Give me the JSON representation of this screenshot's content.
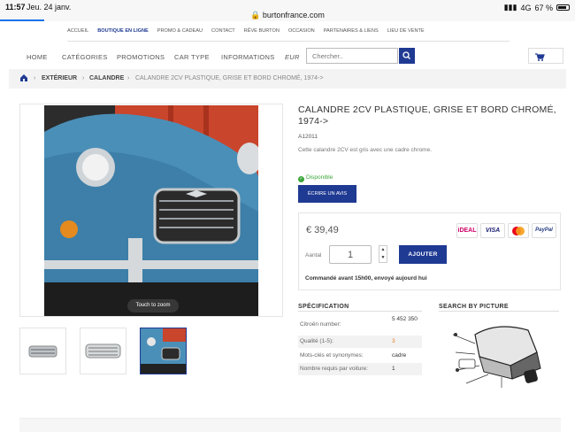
{
  "statusbar": {
    "time": "11:57",
    "date": "Jeu. 24 janv.",
    "url": "burtonfrance.com",
    "network": "4G",
    "battery": "67 %"
  },
  "toplinks": [
    "ACCUEIL",
    "BOUTIQUE EN LIGNE",
    "PROMO & CADEAU",
    "CONTACT",
    "RÊVE BURTON",
    "OCCASION",
    "PARTENAIRES & LIENS",
    "LIEU DE VENTE"
  ],
  "nav": {
    "items": [
      "HOME",
      "CATÉGORIES",
      "PROMOTIONS",
      "CAR TYPE",
      "INFORMATIONS"
    ],
    "currency": "EUR",
    "search_placeholder": "Chercher.."
  },
  "breadcrumb": {
    "level1": "EXTÉRIEUR",
    "level2": "CALANDRE",
    "current": "CALANDRE 2CV PLASTIQUE, GRISE ET BORD CHROMÉ, 1974->"
  },
  "product": {
    "title": "CALANDRE 2CV PLASTIQUE, GRISE ET BORD CHROMÉ, 1974->",
    "ref": "A12011",
    "description": "Cette calandre 2CV est gris avec une cadre chrome.",
    "stock": "Disponible",
    "review_button": "ÉCRIRE UN AVIS",
    "zoom_hint": "Touch to zoom",
    "price": "€ 39,49",
    "qty_label": "Aantal",
    "qty_value": "1",
    "add_button": "AJOUTER",
    "order_note": "Commandé avant 15h00, envoyé aujourd hui",
    "payments": [
      "iDEAL",
      "VISA",
      "MC",
      "PayPal"
    ]
  },
  "spec": {
    "title": "SPÉCIFICATION",
    "rows": [
      {
        "key": "Citroën number:",
        "value": "5 452 350"
      },
      {
        "key": "Qualité (1-5):",
        "value": "3"
      },
      {
        "key": "Mots-clés et synonymes:",
        "value": "cadre"
      },
      {
        "key": "Nombre requis par voiture:",
        "value": "1"
      }
    ]
  },
  "search_by_picture": {
    "title": "SEARCH BY PICTURE"
  },
  "colors": {
    "brand": "#1f3a93",
    "stock_green": "#3ba63b",
    "quality_orange": "#e67e22"
  }
}
